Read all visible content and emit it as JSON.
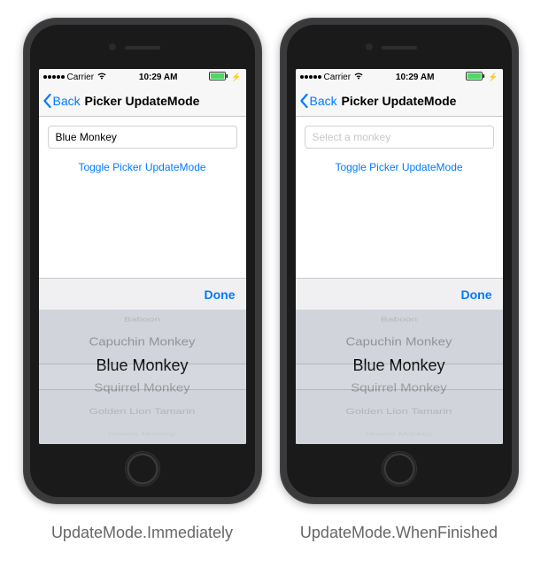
{
  "status_bar": {
    "carrier": "Carrier",
    "time": "10:29 AM"
  },
  "nav": {
    "back_label": "Back",
    "title": "Picker UpdateMode"
  },
  "content": {
    "toggle_label": "Toggle Picker UpdateMode",
    "done_label": "Done"
  },
  "phone_left": {
    "input_value": "Blue Monkey",
    "input_is_placeholder": false
  },
  "phone_right": {
    "input_value": "Select a monkey",
    "input_is_placeholder": true
  },
  "picker_items": [
    "Baboon",
    "Capuchin Monkey",
    "Blue Monkey",
    "Squirrel Monkey",
    "Golden Lion Tamarin",
    "Howler Monkey"
  ],
  "captions": {
    "left": "UpdateMode.Immediately",
    "right": "UpdateMode.WhenFinished"
  }
}
